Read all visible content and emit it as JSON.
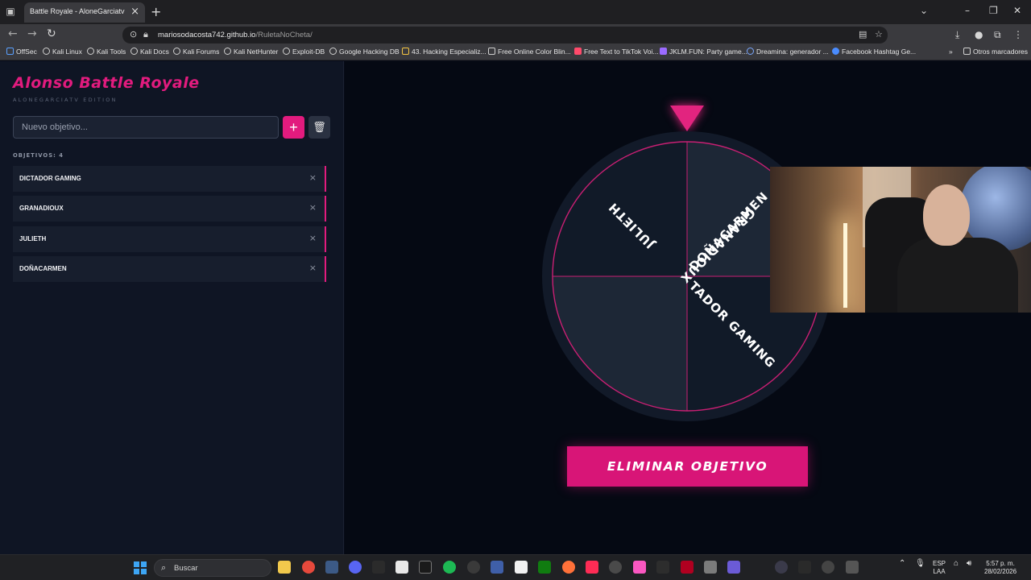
{
  "browser": {
    "tab_title": "Battle Royale - AloneGarciatv",
    "url_host": "mariosodacosta742.github.io",
    "url_path": "/RuletaNoCheta/",
    "bookmarks": [
      "OffSec",
      "Kali Linux",
      "Kali Tools",
      "Kali Docs",
      "Kali Forums",
      "Kali NetHunter",
      "Exploit-DB",
      "Google Hacking DB",
      "43. Hacking Especializ...",
      "Free Online Color Blin...",
      "Free Text to TikTok Voi...",
      "JKLM.FUN: Party game...",
      "Dreamina: generador ...",
      "Facebook Hashtag Ge..."
    ],
    "other_bookmarks": "Otros marcadores"
  },
  "app": {
    "title": "Alonso Battle Royale",
    "subtitle": "ALONEGARCIATV EDITION",
    "input_placeholder": "Nuevo objetivo...",
    "add_label": "+",
    "count_label": "OBJETIVOS: 4",
    "items": [
      "DICTADOR GAMING",
      "GRANADIOUX",
      "JULIETH",
      "DOÑACARMEN"
    ],
    "remove_label": "×",
    "eliminate_button": "ELIMINAR OBJETIVO",
    "wheel_segments": [
      "DOÑACARMEN",
      "TADOR GAMING",
      "GRANADIOUX",
      "JULIETH"
    ],
    "accent_color": "#e21b7e"
  },
  "taskbar": {
    "search_placeholder": "Buscar",
    "lang_top": "ESP",
    "lang_bottom": "LAA",
    "time": "5:57 p. m.",
    "date": "28/02/2026"
  }
}
